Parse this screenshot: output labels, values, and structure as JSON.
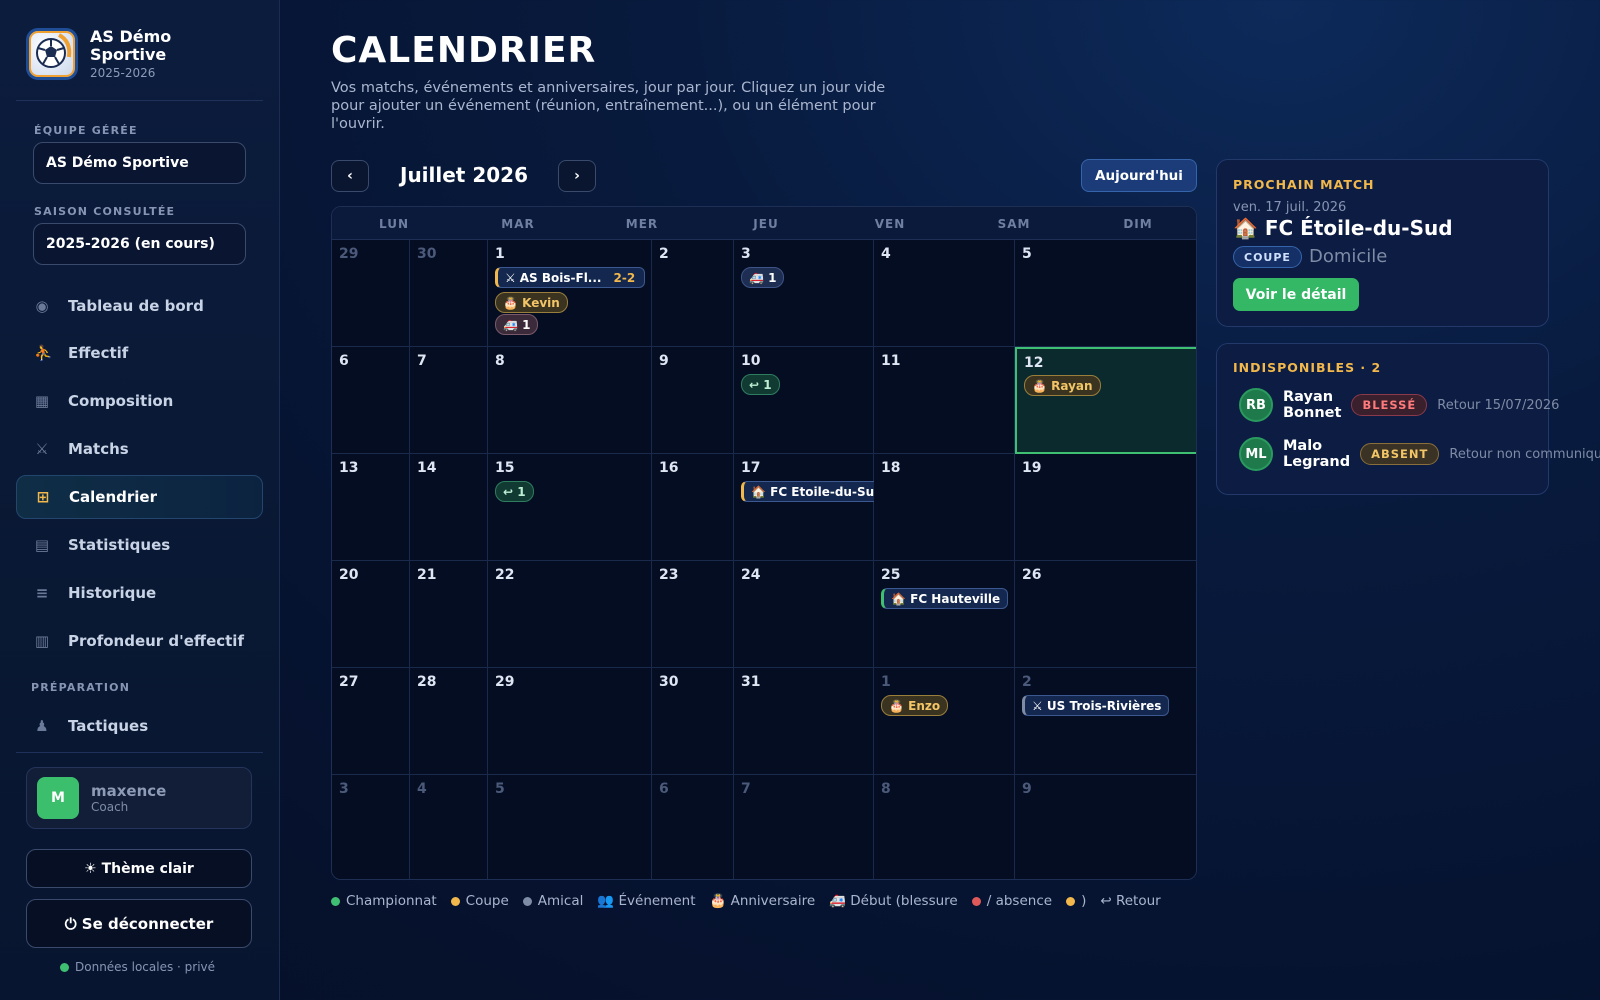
{
  "brand": {
    "name_line1": "AS Démo",
    "name_line2": "Sportive",
    "season": "2025-2026"
  },
  "sidebar": {
    "team_label": "ÉQUIPE GÉRÉE",
    "team_value": "AS Démo Sportive",
    "season_label": "SAISON CONSULTÉE",
    "season_value": "2025-2026 (en cours)",
    "items": [
      {
        "label": "Tableau de bord",
        "icon": "◉"
      },
      {
        "label": "Effectif",
        "icon": "⛹"
      },
      {
        "label": "Composition",
        "icon": "▦"
      },
      {
        "label": "Matchs",
        "icon": "⚔"
      },
      {
        "label": "Calendrier",
        "icon": "⊞"
      },
      {
        "label": "Statistiques",
        "icon": "▤"
      },
      {
        "label": "Historique",
        "icon": "≡"
      },
      {
        "label": "Profondeur d'effectif",
        "icon": "▥"
      }
    ],
    "prep_label": "PRÉPARATION",
    "prep_item": {
      "label": "Tactiques",
      "icon": "♟"
    },
    "user": {
      "initial": "M",
      "name": "maxence",
      "role": "Coach"
    },
    "theme_button": "☀ Thème clair",
    "logout_button": "⏻ Se déconnecter",
    "local_text": "Données locales · privé"
  },
  "header": {
    "title": "CALENDRIER",
    "subtitle": "Vos matchs, événements et anniversaires, jour par jour. Cliquez un jour vide pour ajouter un événement (réunion, entraînement...), ou un élément pour l'ouvrir."
  },
  "calendar": {
    "month": "Juillet 2026",
    "prev": "‹",
    "next": "›",
    "today_button": "Aujourd'hui",
    "weekdays": [
      "LUN",
      "MAR",
      "MER",
      "JEU",
      "VEN",
      "SAM",
      "DIM"
    ],
    "weeks": [
      [
        "29",
        "30",
        "1",
        "2",
        "3",
        "4",
        "5"
      ],
      [
        "6",
        "7",
        "8",
        "9",
        "10",
        "11",
        "12"
      ],
      [
        "13",
        "14",
        "15",
        "16",
        "17",
        "18",
        "19"
      ],
      [
        "20",
        "21",
        "22",
        "23",
        "24",
        "25",
        "26"
      ],
      [
        "27",
        "28",
        "29",
        "30",
        "31",
        "1",
        "2"
      ],
      [
        "3",
        "4",
        "5",
        "6",
        "7",
        "8",
        "9"
      ]
    ],
    "events": {
      "w0d2_match": {
        "icon": "⚔",
        "label": "AS Bois-Fl...",
        "score": "2-2"
      },
      "w0d2_bday": "🎂 Kevin",
      "w0d2_inj": "🚑 1",
      "w0d4_inj": "🚑 1",
      "w1d4_ret": "↩ 1",
      "w1d6_bday": "🎂 Rayan",
      "w2d2_ret": "↩ 1",
      "w2d4_match": "🏠 FC Etoile-du-Sud",
      "w3d5_match": "🏠 FC Hauteville",
      "w4d5_bday": "🎂 Enzo",
      "w4d6_match": "⚔ US Trois-Rivières"
    }
  },
  "legend": {
    "items": [
      {
        "label": "Championnat",
        "color": "#3fbf72"
      },
      {
        "label": "Coupe",
        "color": "#f2b84b"
      },
      {
        "label": "Amical",
        "color": "#7f8ca6"
      },
      {
        "label": "👥 Événement"
      },
      {
        "label": "🎂 Anniversaire"
      },
      {
        "label": "🚑 Début (blessure"
      },
      {
        "label": "/ absence",
        "color": "#e05a5a"
      },
      {
        "label": ")",
        "color": "#f2b84b"
      },
      {
        "label": "↩ Retour"
      }
    ]
  },
  "next_match": {
    "title": "PROCHAIN MATCH",
    "date": "ven. 17 juil. 2026",
    "team": "🏠 FC Étoile-du-Sud",
    "competition": "COUPE",
    "venue": "Domicile",
    "button": "Voir le détail"
  },
  "unavailable": {
    "title": "INDISPONIBLES · 2",
    "players": [
      {
        "initials": "RB",
        "first": "Rayan",
        "last": "Bonnet",
        "status": "BLESSÉ",
        "return": "Retour 15/07/2026"
      },
      {
        "initials": "ML",
        "first": "Malo",
        "last": "Legrand",
        "status": "ABSENT",
        "return": "Retour non communiqué"
      }
    ]
  },
  "colors": {
    "accent": "#3fbf72",
    "gold": "#f2b84b",
    "injury": "#ff7a7a"
  }
}
